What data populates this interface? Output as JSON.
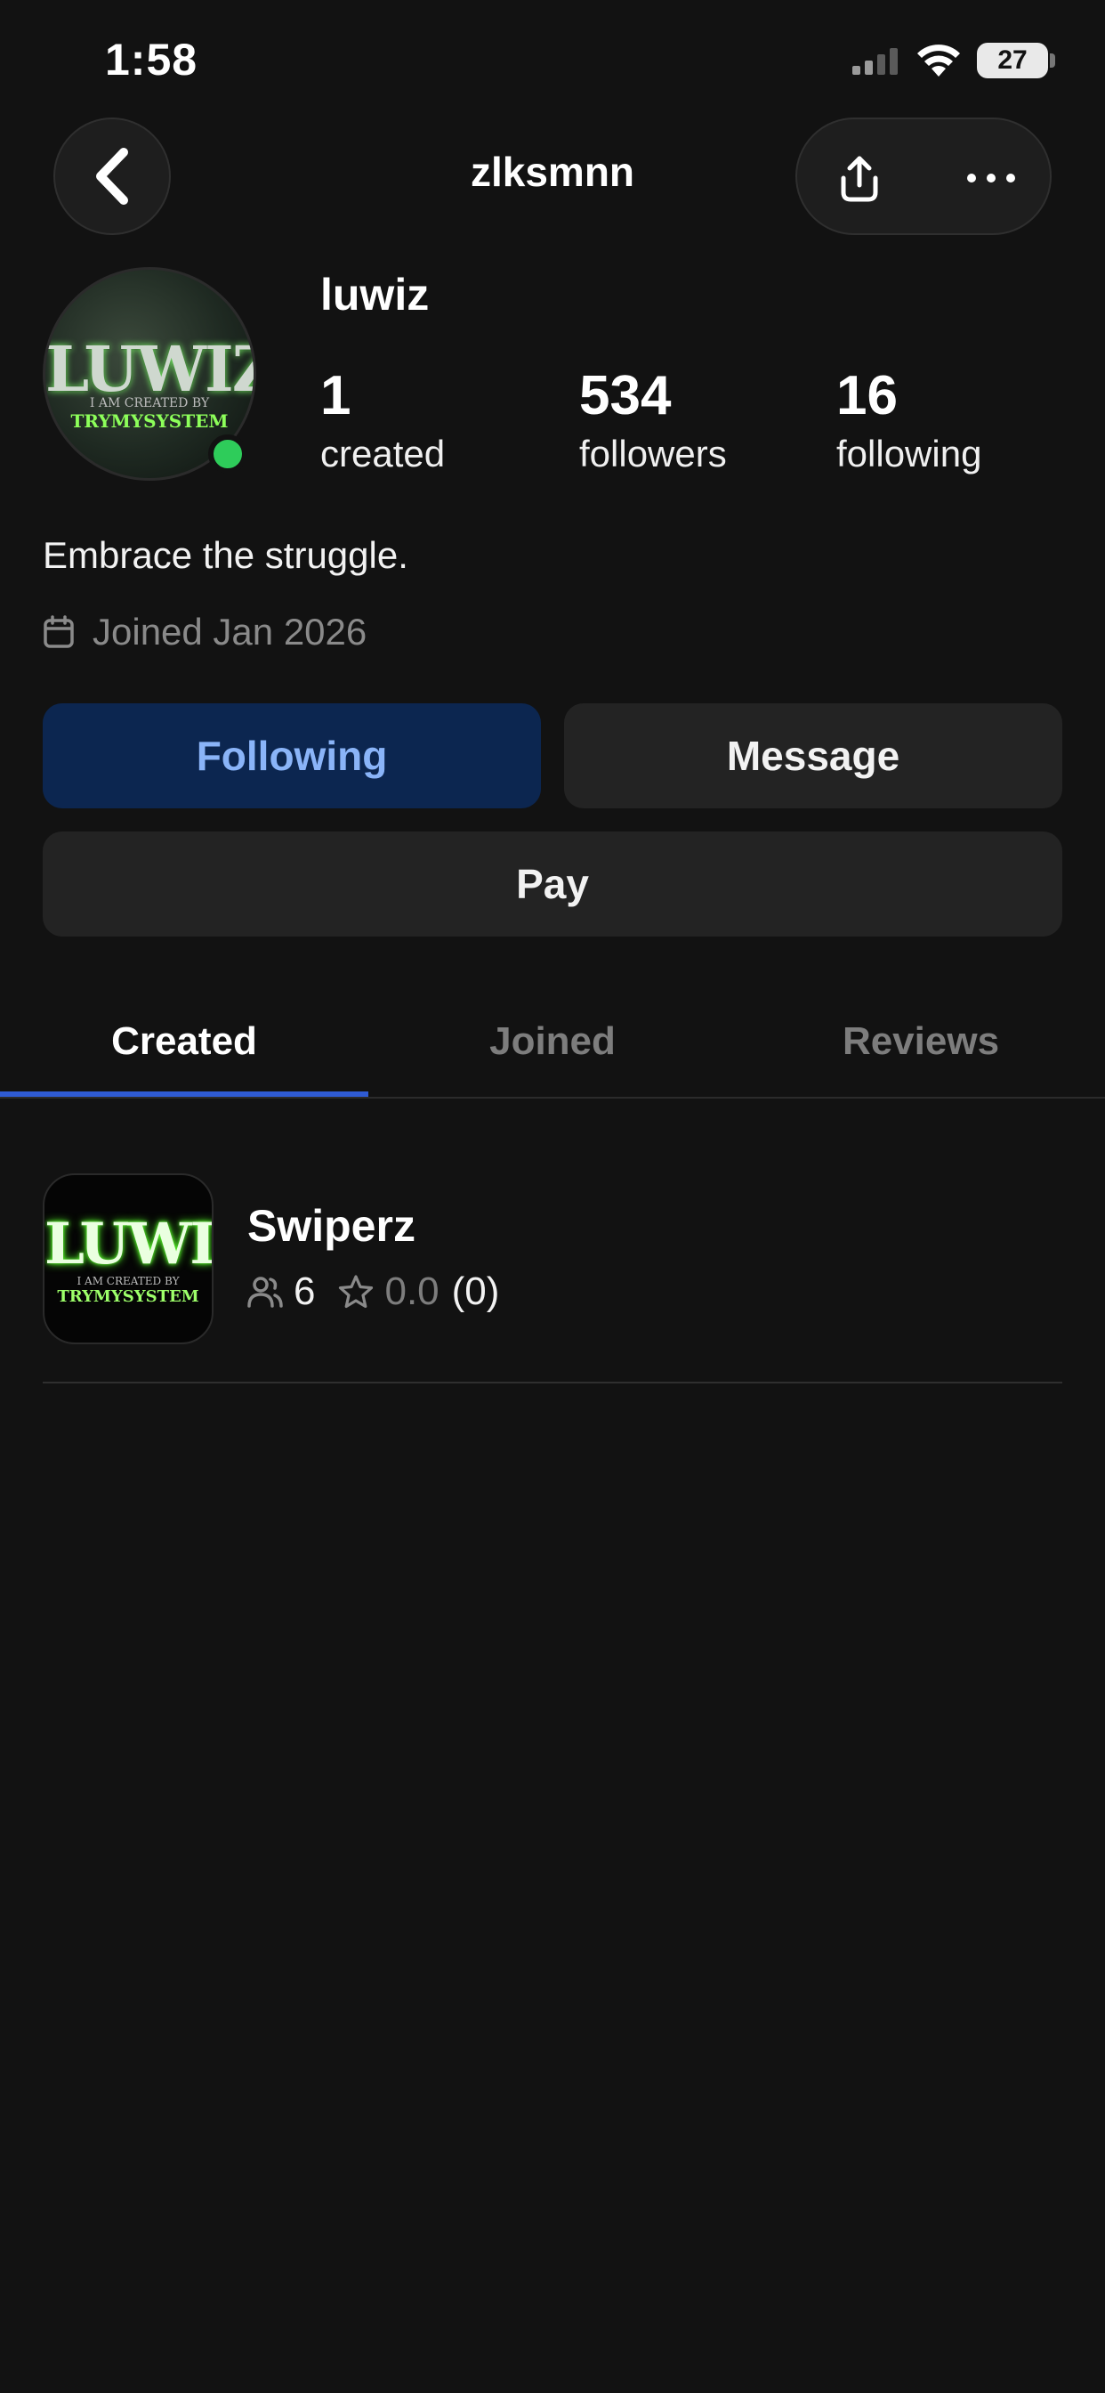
{
  "status_bar": {
    "time": "1:58",
    "battery": "27"
  },
  "nav": {
    "title": "zlksmnn"
  },
  "profile": {
    "display_name": "luwiz",
    "avatar_logo_text": "LUWIZ",
    "avatar_sub_text": "I AM CREATED BY",
    "avatar_brand_text": "TRYMYSYSTEM",
    "stats": [
      {
        "value": "1",
        "label": "created"
      },
      {
        "value": "534",
        "label": "followers"
      },
      {
        "value": "16",
        "label": "following"
      }
    ],
    "bio": "Embrace the struggle.",
    "joined": "Joined Jan 2026",
    "online_color": "#2ecc5a"
  },
  "actions": {
    "following_label": "Following",
    "message_label": "Message",
    "pay_label": "Pay"
  },
  "tabs": [
    {
      "label": "Created",
      "active": true
    },
    {
      "label": "Joined",
      "active": false
    },
    {
      "label": "Reviews",
      "active": false
    }
  ],
  "items": [
    {
      "title": "Swiperz",
      "thumb_logo_text": "LUWIZ",
      "thumb_sub_text": "I AM CREATED BY",
      "thumb_brand_text": "TRYMYSYSTEM",
      "members": "6",
      "rating": "0.0",
      "rating_count": "(0)"
    }
  ],
  "colors": {
    "accent": "#2f5bd3",
    "following_bg": "#0c2650",
    "following_text": "#8ab4f8"
  }
}
